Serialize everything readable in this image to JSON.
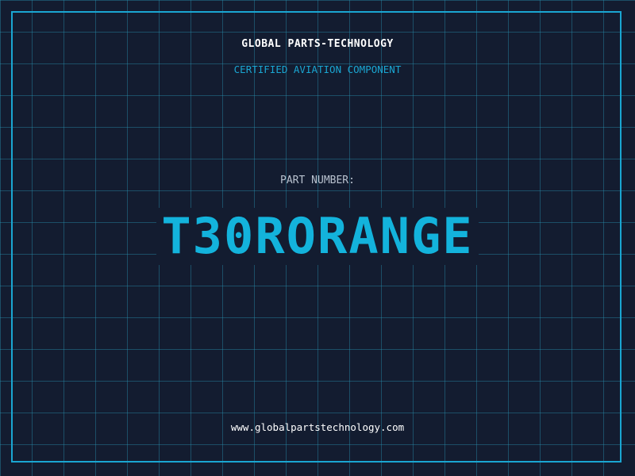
{
  "header": {
    "company": "GLOBAL PARTS-TECHNOLOGY",
    "subtitle": "CERTIFIED AVIATION COMPONENT"
  },
  "part": {
    "label": "PART NUMBER:",
    "number": "T30RORANGE"
  },
  "footer": {
    "website": "www.globalpartstechnology.com"
  },
  "colors": {
    "background": "#131c30",
    "grid": "#288caa",
    "accent": "#13b3dc",
    "text": "#ffffff",
    "label": "#b9c2cf"
  }
}
